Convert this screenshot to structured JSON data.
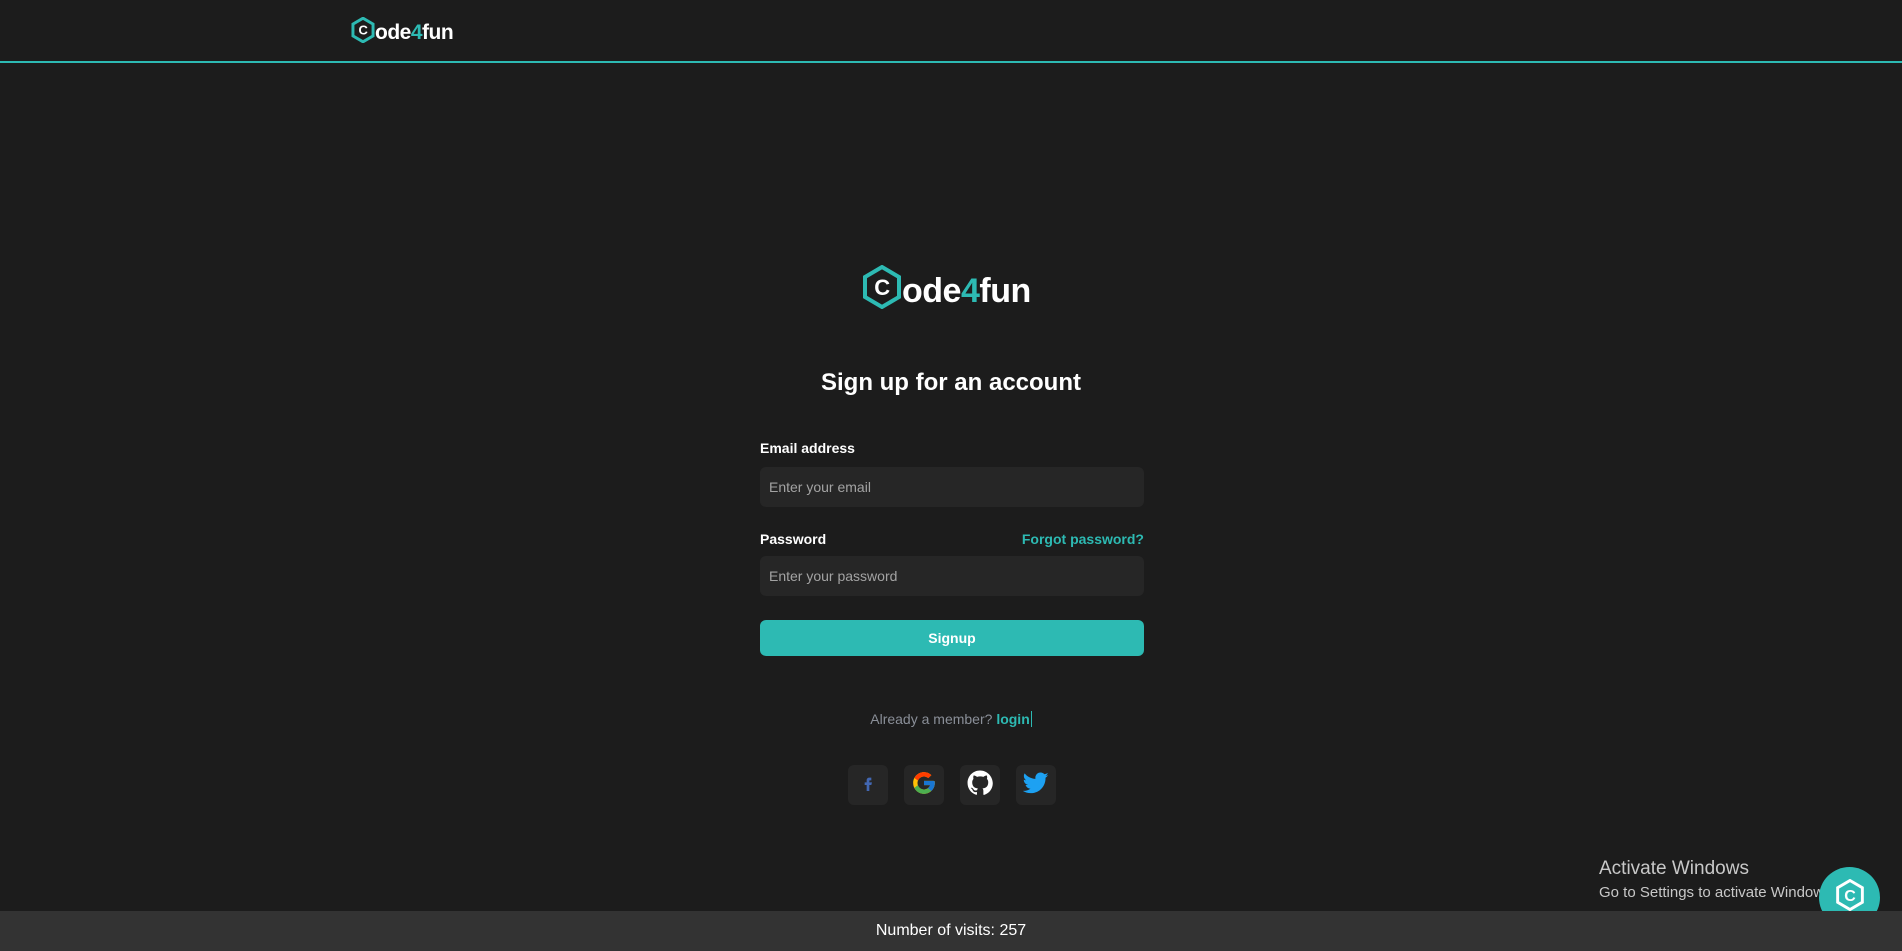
{
  "brand": {
    "name_prefix": "ode",
    "name_four": "4",
    "name_suffix": "fun",
    "accent": "#2dbab3",
    "logo_icon": "hexagon-c-icon"
  },
  "form": {
    "title": "Sign up for an account",
    "email_label": "Email address",
    "email_placeholder": "Enter your email",
    "email_value": "",
    "password_label": "Password",
    "forgot_label": "Forgot password?",
    "password_placeholder": "Enter your password",
    "password_value": "",
    "submit_label": "Signup"
  },
  "member": {
    "text": "Already a member?",
    "link": "login"
  },
  "socials": [
    "facebook-icon",
    "google-icon",
    "github-icon",
    "twitter-icon"
  ],
  "watermark": {
    "line1": "Activate Windows",
    "line2": "Go to Settings to activate Windows."
  },
  "footer": {
    "text": "Number of visits: 257"
  }
}
